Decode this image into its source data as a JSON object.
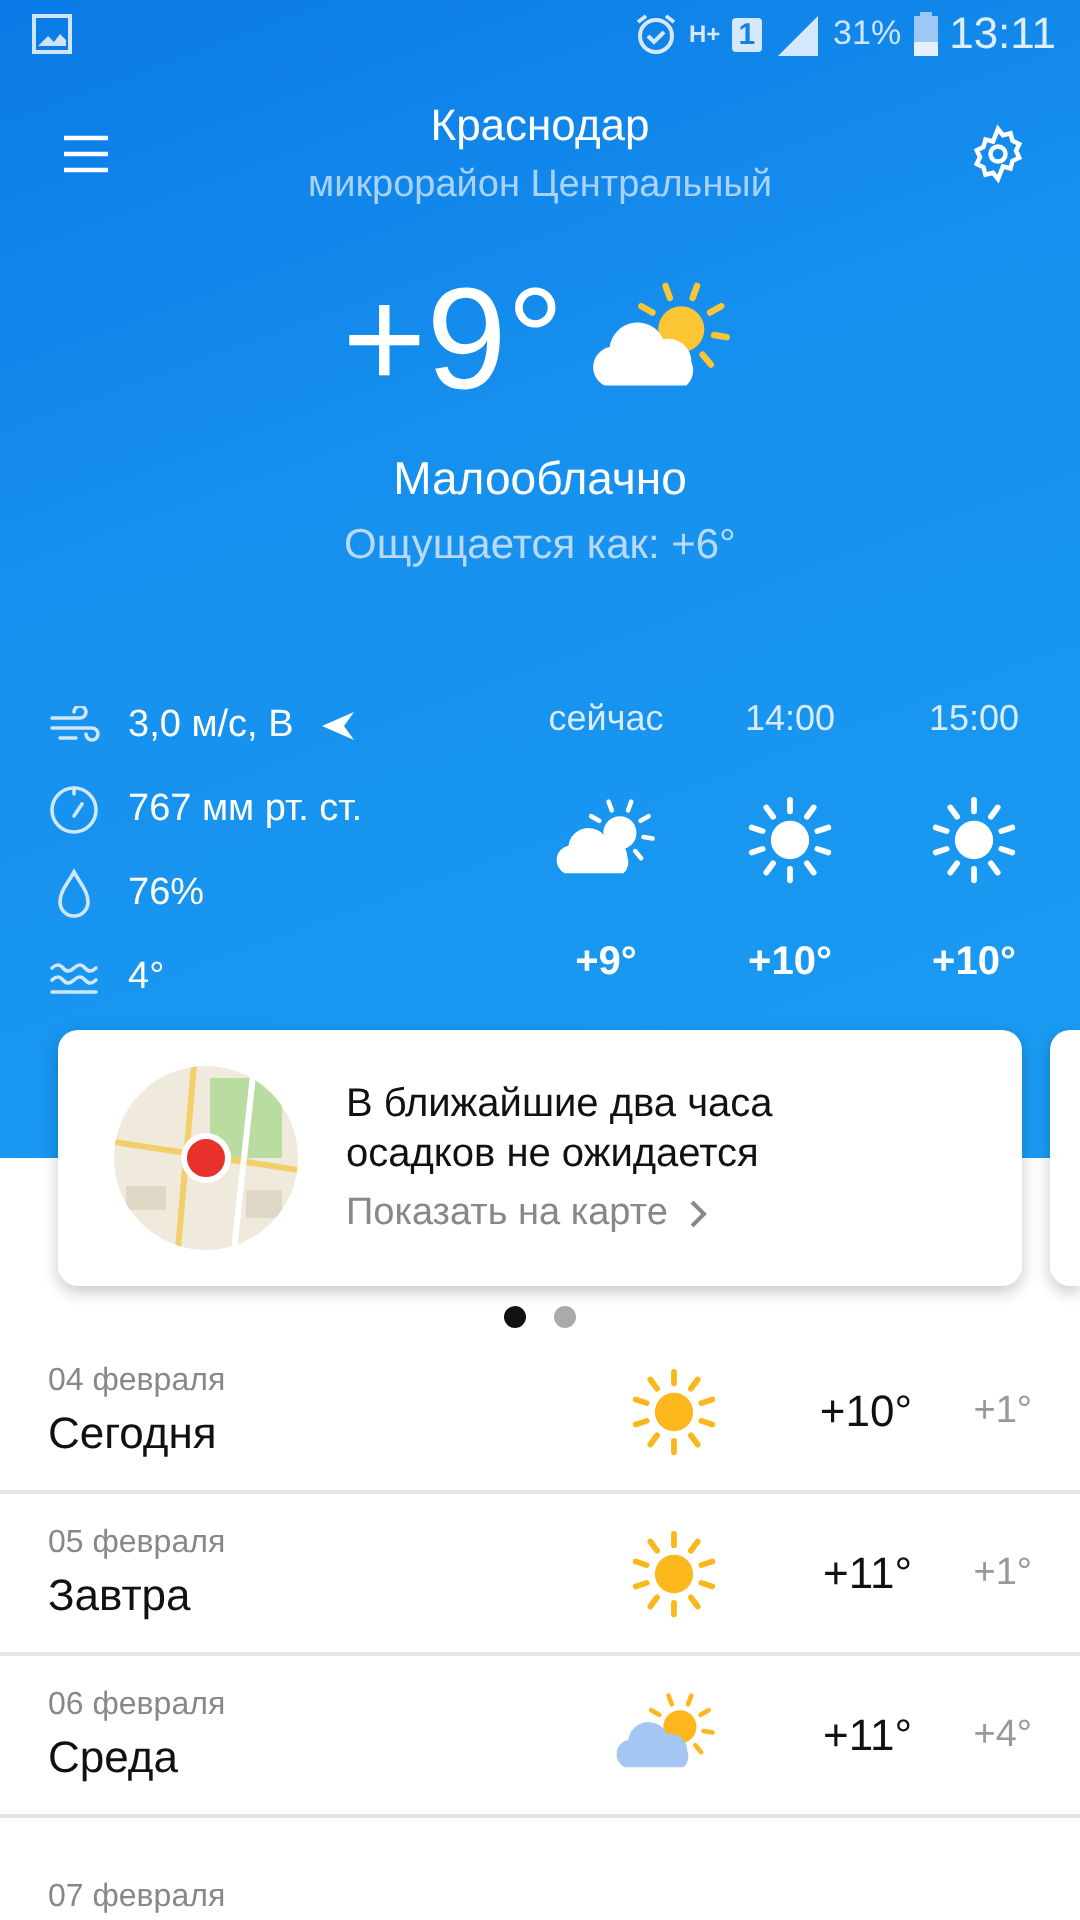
{
  "status_bar": {
    "network": "H+",
    "sim": "1",
    "battery": "31%",
    "time": "13:11"
  },
  "header": {
    "city": "Краснодар",
    "district": "микрорайон Центральный"
  },
  "current": {
    "temperature": "+9°",
    "kind": "partly_cloudy",
    "condition": "Малооблачно",
    "feels_like": "Ощущается как: +6°"
  },
  "details": [
    {
      "kind": "wind",
      "text": "3,0 м/с, В"
    },
    {
      "kind": "pressure",
      "text": "767 мм рт. ст."
    },
    {
      "kind": "humidity",
      "text": "76%"
    },
    {
      "kind": "water",
      "text": "4°"
    }
  ],
  "hourly": [
    {
      "time": "сейчас",
      "kind": "partly_cloudy",
      "temp": "+9°"
    },
    {
      "time": "14:00",
      "kind": "sun",
      "temp": "+10°"
    },
    {
      "time": "15:00",
      "kind": "sun",
      "temp": "+10°"
    }
  ],
  "card": {
    "line1": "В ближайшие два часа",
    "line2": "осадков не ожидается",
    "link": "Показать на карте"
  },
  "pager": [
    {
      "selected": true
    },
    {
      "selected": false
    }
  ],
  "days": [
    {
      "date": "04 февраля",
      "name": "Сегодня",
      "kind": "sun",
      "high": "+10°",
      "low": "+1°"
    },
    {
      "date": "05 февраля",
      "name": "Завтра",
      "kind": "sun",
      "high": "+11°",
      "low": "+1°"
    },
    {
      "date": "06 февраля",
      "name": "Среда",
      "kind": "partly_cloudy",
      "high": "+11°",
      "low": "+4°"
    },
    {
      "date": "07 февраля"
    }
  ]
}
